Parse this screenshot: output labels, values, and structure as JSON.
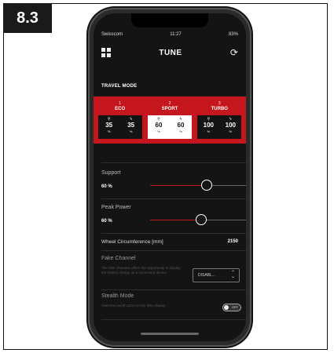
{
  "figure_label": "8.3",
  "status_bar": {
    "carrier": "Swisscom",
    "time": "11:27",
    "battery": "83%"
  },
  "nav": {
    "title": "TUNE"
  },
  "travel_mode": {
    "header": "TRAVEL MODE",
    "modes": [
      {
        "number": "1",
        "name": "ECO",
        "support": "35",
        "peak": "35",
        "unit": "%"
      },
      {
        "number": "2",
        "name": "SPORT",
        "support": "60",
        "peak": "60",
        "unit": "%"
      },
      {
        "number": "3",
        "name": "TURBO",
        "support": "100",
        "peak": "100",
        "unit": "%"
      }
    ],
    "active_index": 1
  },
  "support": {
    "label": "Support",
    "value": "60 %",
    "level_percent": 60
  },
  "peak_power": {
    "label": "Peak Power",
    "value": "60 %",
    "level_percent": 60
  },
  "wheel_circumference": {
    "label": "Wheel Circumference [mm]",
    "value": "2150"
  },
  "fake_channel": {
    "label": "Fake Channel",
    "description": "The fake channels offers the opportunity to display the battery charge on a connected device.",
    "selected": "DISABL..."
  },
  "stealth_mode": {
    "label": "Stealth Mode",
    "description": "Switches on/off LEDs on the bike display",
    "toggle_text": "OFF"
  },
  "colors": {
    "accent": "#c4161c",
    "background": "#141414"
  },
  "icons": [
    "grid-icon",
    "refresh-icon",
    "bike-icon",
    "bolt-icon",
    "chevron-updown-icon"
  ]
}
